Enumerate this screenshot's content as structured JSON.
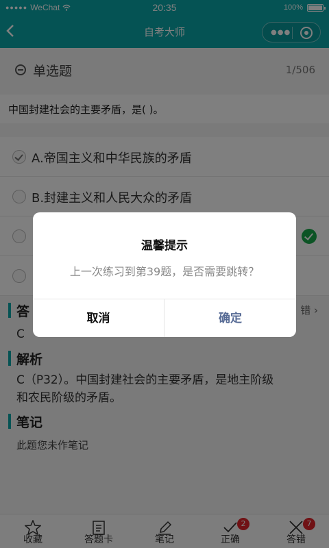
{
  "status_bar": {
    "carrier": "WeChat",
    "time": "20:35",
    "battery": "100%"
  },
  "nav": {
    "title": "自考大师",
    "back_icon": "chevron-left-icon"
  },
  "question_header": {
    "type_label": "单选题",
    "counter": "1/506"
  },
  "question": {
    "text": "中国封建社会的主要矛盾，是( )。"
  },
  "options": [
    {
      "text": "A.帝国主义和中华民族的矛盾",
      "checked": true
    },
    {
      "text": "B.封建主义和人民大众的矛盾",
      "checked": false
    },
    {
      "text": "",
      "checked": false,
      "correct": true
    },
    {
      "text": "",
      "checked": false
    }
  ],
  "answer_section": {
    "title": "答",
    "value": "C",
    "report_label": "错"
  },
  "analysis_section": {
    "title": "解析",
    "line1": "C（P32）。中国封建社会的主要矛盾，是地主阶级",
    "line2": "和农民阶级的矛盾。"
  },
  "note_section": {
    "title": "笔记",
    "text": "此题您未作笔记"
  },
  "tabbar": [
    {
      "label": "收藏",
      "icon": "star-icon"
    },
    {
      "label": "答题卡",
      "icon": "clipboard-icon"
    },
    {
      "label": "笔记",
      "icon": "pencil-icon"
    },
    {
      "label": "正确",
      "icon": "check-icon",
      "badge": "2"
    },
    {
      "label": "答错",
      "icon": "x-icon",
      "badge": "7"
    }
  ],
  "dialog": {
    "title": "温馨提示",
    "message": "上一次练习到第39题，是否需要跳转？",
    "cancel_label": "取消",
    "confirm_label": "确定"
  },
  "colors": {
    "primary": "#0aa7a8",
    "correct": "#18a84a",
    "badge": "#e0252b",
    "dialog_confirm": "#576b95"
  }
}
